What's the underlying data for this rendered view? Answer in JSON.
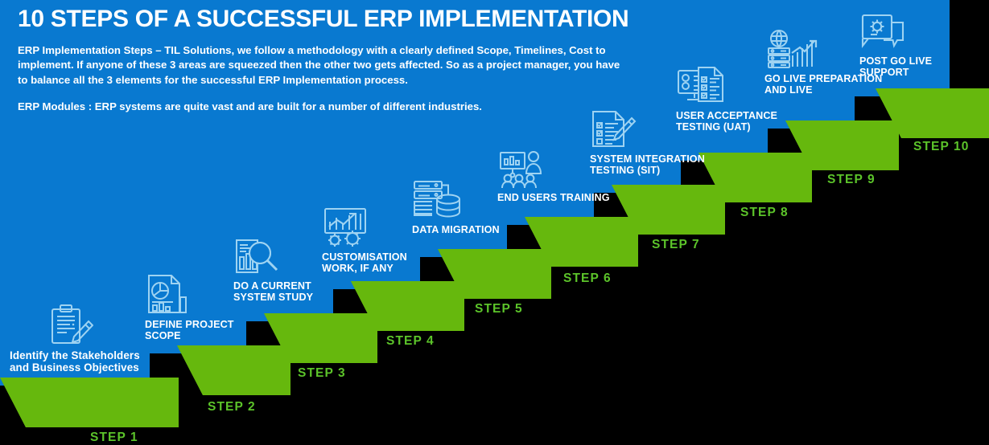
{
  "header": {
    "title": "10 STEPS OF A SUCCESSFUL ERP IMPLEMENTATION",
    "paragraph1": "ERP Implementation Steps – TIL Solutions, we follow a methodology with a clearly defined Scope, Timelines, Cost to implement. If anyone of these 3 areas are squeezed then the other two gets affected. So as a project manager, you have to balance all the 3 elements for the successful ERP Implementation process.",
    "paragraph2": "ERP Modules : ERP systems are quite vast and are built for a number of different industries."
  },
  "colors": {
    "blue": "#0979d0",
    "green_top": "#66b80d",
    "green_side": "#4b9a13",
    "step_label_green": "#5cc42a",
    "background": "#000000",
    "icon_stroke": "#9ed3f2",
    "text_white": "#ffffff"
  },
  "steps": [
    {
      "number": "STEP 1",
      "label": "Identify the Stakeholders and Business Objectives",
      "icon": "clipboard-pencil-icon",
      "mixed_case": true
    },
    {
      "number": "STEP 2",
      "label": "DEFINE PROJECT SCOPE",
      "icon": "report-piechart-barchart-icon",
      "mixed_case": false
    },
    {
      "number": "STEP 3",
      "label": "DO A CURRENT SYSTEM STUDY",
      "icon": "magnifier-barchart-icon",
      "mixed_case": false
    },
    {
      "number": "STEP 4",
      "label": "CUSTOMISATION WORK, IF ANY",
      "icon": "chart-gears-icon",
      "mixed_case": false
    },
    {
      "number": "STEP 5",
      "label": "DATA MIGRATION",
      "icon": "servers-database-icon",
      "mixed_case": false
    },
    {
      "number": "STEP 6",
      "label": "END USERS TRAINING",
      "icon": "presentation-training-icon",
      "mixed_case": false
    },
    {
      "number": "STEP 7",
      "label": "SYSTEM INTEGRATION TESTING (SIT)",
      "icon": "checklist-pen-icon",
      "mixed_case": false
    },
    {
      "number": "STEP 8",
      "label": "USER ACCEPTANCE TESTING (UAT)",
      "icon": "monitor-checklist-icon",
      "mixed_case": false
    },
    {
      "number": "STEP 9",
      "label": "GO LIVE PREPARATION AND LIVE",
      "icon": "globe-servers-growth-icon",
      "mixed_case": false
    },
    {
      "number": "STEP 10",
      "label": "POST GO LIVE SUPPORT",
      "icon": "gear-chat-support-icon",
      "mixed_case": false
    }
  ]
}
